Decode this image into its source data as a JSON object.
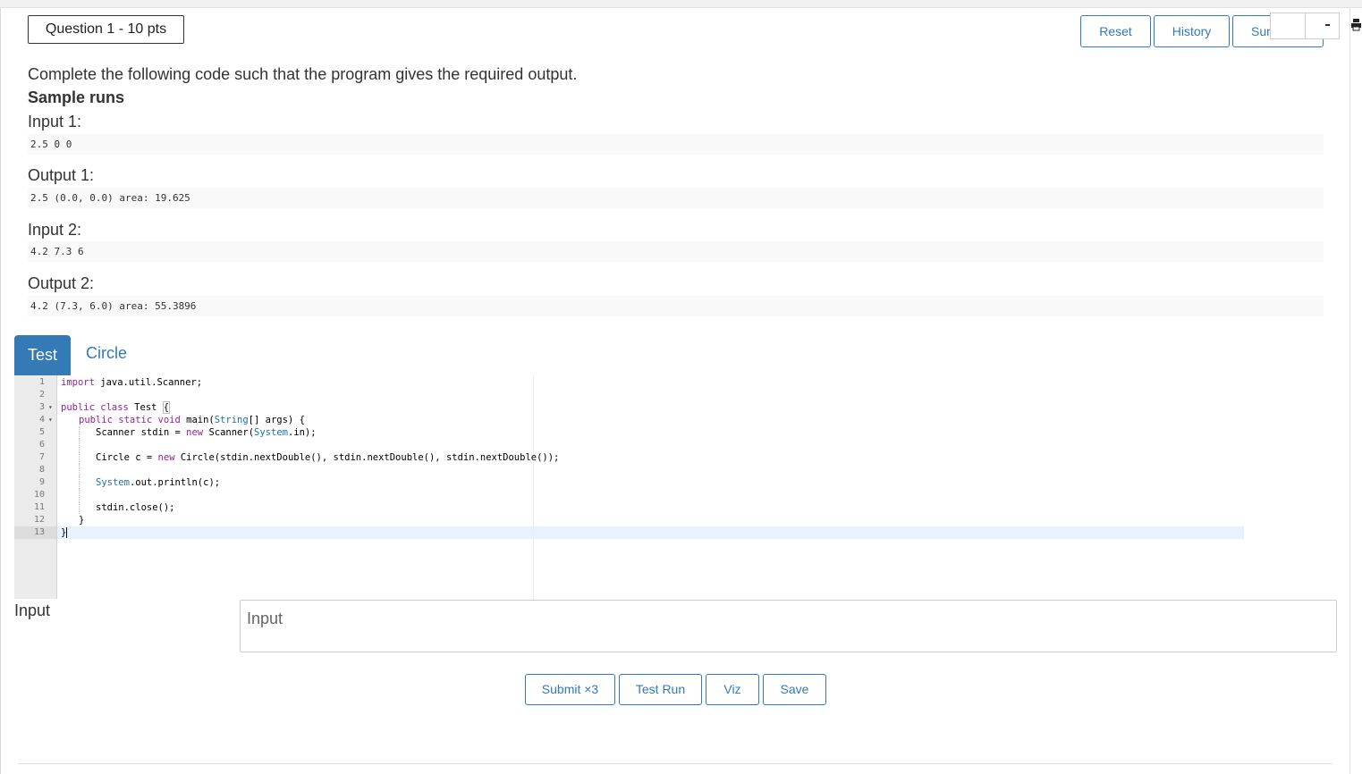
{
  "question": {
    "label": "Question 1 - 10 pts"
  },
  "toolbar": {
    "reset": "Reset",
    "history": "History",
    "summary": "Summary"
  },
  "prompt": {
    "text": "Complete the following code such that the program gives the required output.",
    "sample_title": "Sample runs",
    "samples": [
      {
        "label": "Input 1:",
        "code": "2.5 0 0"
      },
      {
        "label": "Output 1:",
        "code": "2.5 (0.0, 0.0) area: 19.625"
      },
      {
        "label": "Input 2:",
        "code": "4.2 7.3 6"
      },
      {
        "label": "Output 2:",
        "code": "4.2 (7.3, 6.0) area: 55.3896"
      }
    ]
  },
  "tabs": [
    {
      "label": "Test",
      "active": true
    },
    {
      "label": "Circle",
      "active": false
    }
  ],
  "editor": {
    "line_numbers": [
      "1",
      "2",
      "3",
      "4",
      "5",
      "6",
      "7",
      "8",
      "9",
      "10",
      "11",
      "12",
      "13"
    ],
    "fold_markers": {
      "3": "▾",
      "4": "▾"
    },
    "active_line": 13,
    "code": {
      "l1_kw": "import",
      "l1_rest": " java.util.Scanner;",
      "l3_kw": "public class",
      "l3_name": " Test ",
      "l3_brace": "{",
      "l4_kw": "public static void",
      "l4_main": " main(",
      "l4_type": "String",
      "l4_rest": "[] args) {",
      "l5_a": "Scanner stdin = ",
      "l5_kw": "new",
      "l5_b": " Scanner(",
      "l5_type": "System",
      "l5_c": ".in);",
      "l7_a": "Circle c = ",
      "l7_kw": "new",
      "l7_b": " Circle(stdin.nextDouble(), stdin.nextDouble(), stdin.nextDouble());",
      "l9_type": "System",
      "l9_rest": ".out.println(c);",
      "l11": "stdin.close();",
      "l12": "}",
      "l13": "}"
    }
  },
  "input": {
    "label": "Input",
    "placeholder": "Input",
    "value": ""
  },
  "actions": {
    "submit": "Submit ×3",
    "test_run": "Test Run",
    "viz": "Viz",
    "save": "Save"
  },
  "colors": {
    "accent": "#337ab7",
    "keyword": "#931f9c",
    "type": "#1a6fa8",
    "active_line": "#e8f2fe"
  },
  "icons": {
    "print": "printer-icon"
  }
}
